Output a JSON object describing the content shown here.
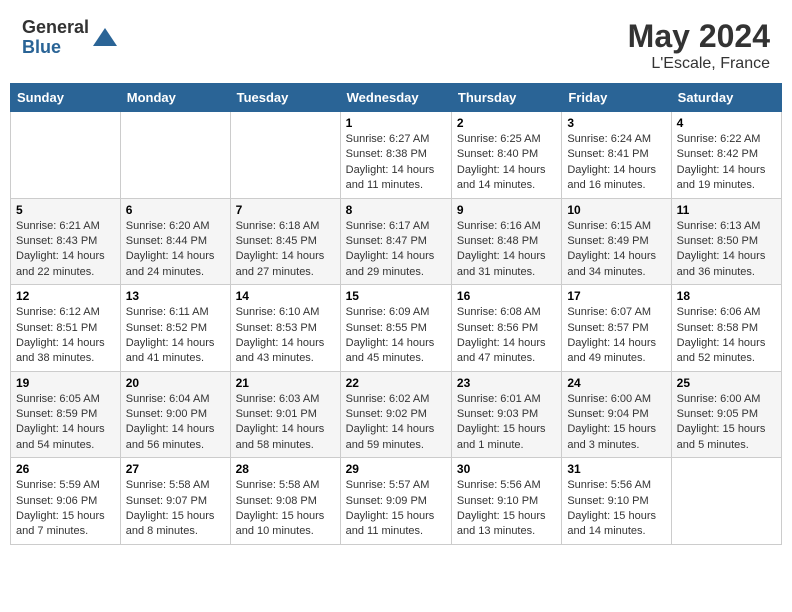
{
  "header": {
    "logo_line1": "General",
    "logo_line2": "Blue",
    "month_year": "May 2024",
    "location": "L'Escale, France"
  },
  "days_of_week": [
    "Sunday",
    "Monday",
    "Tuesday",
    "Wednesday",
    "Thursday",
    "Friday",
    "Saturday"
  ],
  "weeks": [
    [
      {
        "day": "",
        "info": ""
      },
      {
        "day": "",
        "info": ""
      },
      {
        "day": "",
        "info": ""
      },
      {
        "day": "1",
        "info": "Sunrise: 6:27 AM\nSunset: 8:38 PM\nDaylight: 14 hours\nand 11 minutes."
      },
      {
        "day": "2",
        "info": "Sunrise: 6:25 AM\nSunset: 8:40 PM\nDaylight: 14 hours\nand 14 minutes."
      },
      {
        "day": "3",
        "info": "Sunrise: 6:24 AM\nSunset: 8:41 PM\nDaylight: 14 hours\nand 16 minutes."
      },
      {
        "day": "4",
        "info": "Sunrise: 6:22 AM\nSunset: 8:42 PM\nDaylight: 14 hours\nand 19 minutes."
      }
    ],
    [
      {
        "day": "5",
        "info": "Sunrise: 6:21 AM\nSunset: 8:43 PM\nDaylight: 14 hours\nand 22 minutes."
      },
      {
        "day": "6",
        "info": "Sunrise: 6:20 AM\nSunset: 8:44 PM\nDaylight: 14 hours\nand 24 minutes."
      },
      {
        "day": "7",
        "info": "Sunrise: 6:18 AM\nSunset: 8:45 PM\nDaylight: 14 hours\nand 27 minutes."
      },
      {
        "day": "8",
        "info": "Sunrise: 6:17 AM\nSunset: 8:47 PM\nDaylight: 14 hours\nand 29 minutes."
      },
      {
        "day": "9",
        "info": "Sunrise: 6:16 AM\nSunset: 8:48 PM\nDaylight: 14 hours\nand 31 minutes."
      },
      {
        "day": "10",
        "info": "Sunrise: 6:15 AM\nSunset: 8:49 PM\nDaylight: 14 hours\nand 34 minutes."
      },
      {
        "day": "11",
        "info": "Sunrise: 6:13 AM\nSunset: 8:50 PM\nDaylight: 14 hours\nand 36 minutes."
      }
    ],
    [
      {
        "day": "12",
        "info": "Sunrise: 6:12 AM\nSunset: 8:51 PM\nDaylight: 14 hours\nand 38 minutes."
      },
      {
        "day": "13",
        "info": "Sunrise: 6:11 AM\nSunset: 8:52 PM\nDaylight: 14 hours\nand 41 minutes."
      },
      {
        "day": "14",
        "info": "Sunrise: 6:10 AM\nSunset: 8:53 PM\nDaylight: 14 hours\nand 43 minutes."
      },
      {
        "day": "15",
        "info": "Sunrise: 6:09 AM\nSunset: 8:55 PM\nDaylight: 14 hours\nand 45 minutes."
      },
      {
        "day": "16",
        "info": "Sunrise: 6:08 AM\nSunset: 8:56 PM\nDaylight: 14 hours\nand 47 minutes."
      },
      {
        "day": "17",
        "info": "Sunrise: 6:07 AM\nSunset: 8:57 PM\nDaylight: 14 hours\nand 49 minutes."
      },
      {
        "day": "18",
        "info": "Sunrise: 6:06 AM\nSunset: 8:58 PM\nDaylight: 14 hours\nand 52 minutes."
      }
    ],
    [
      {
        "day": "19",
        "info": "Sunrise: 6:05 AM\nSunset: 8:59 PM\nDaylight: 14 hours\nand 54 minutes."
      },
      {
        "day": "20",
        "info": "Sunrise: 6:04 AM\nSunset: 9:00 PM\nDaylight: 14 hours\nand 56 minutes."
      },
      {
        "day": "21",
        "info": "Sunrise: 6:03 AM\nSunset: 9:01 PM\nDaylight: 14 hours\nand 58 minutes."
      },
      {
        "day": "22",
        "info": "Sunrise: 6:02 AM\nSunset: 9:02 PM\nDaylight: 14 hours\nand 59 minutes."
      },
      {
        "day": "23",
        "info": "Sunrise: 6:01 AM\nSunset: 9:03 PM\nDaylight: 15 hours\nand 1 minute."
      },
      {
        "day": "24",
        "info": "Sunrise: 6:00 AM\nSunset: 9:04 PM\nDaylight: 15 hours\nand 3 minutes."
      },
      {
        "day": "25",
        "info": "Sunrise: 6:00 AM\nSunset: 9:05 PM\nDaylight: 15 hours\nand 5 minutes."
      }
    ],
    [
      {
        "day": "26",
        "info": "Sunrise: 5:59 AM\nSunset: 9:06 PM\nDaylight: 15 hours\nand 7 minutes."
      },
      {
        "day": "27",
        "info": "Sunrise: 5:58 AM\nSunset: 9:07 PM\nDaylight: 15 hours\nand 8 minutes."
      },
      {
        "day": "28",
        "info": "Sunrise: 5:58 AM\nSunset: 9:08 PM\nDaylight: 15 hours\nand 10 minutes."
      },
      {
        "day": "29",
        "info": "Sunrise: 5:57 AM\nSunset: 9:09 PM\nDaylight: 15 hours\nand 11 minutes."
      },
      {
        "day": "30",
        "info": "Sunrise: 5:56 AM\nSunset: 9:10 PM\nDaylight: 15 hours\nand 13 minutes."
      },
      {
        "day": "31",
        "info": "Sunrise: 5:56 AM\nSunset: 9:10 PM\nDaylight: 15 hours\nand 14 minutes."
      },
      {
        "day": "",
        "info": ""
      }
    ]
  ]
}
